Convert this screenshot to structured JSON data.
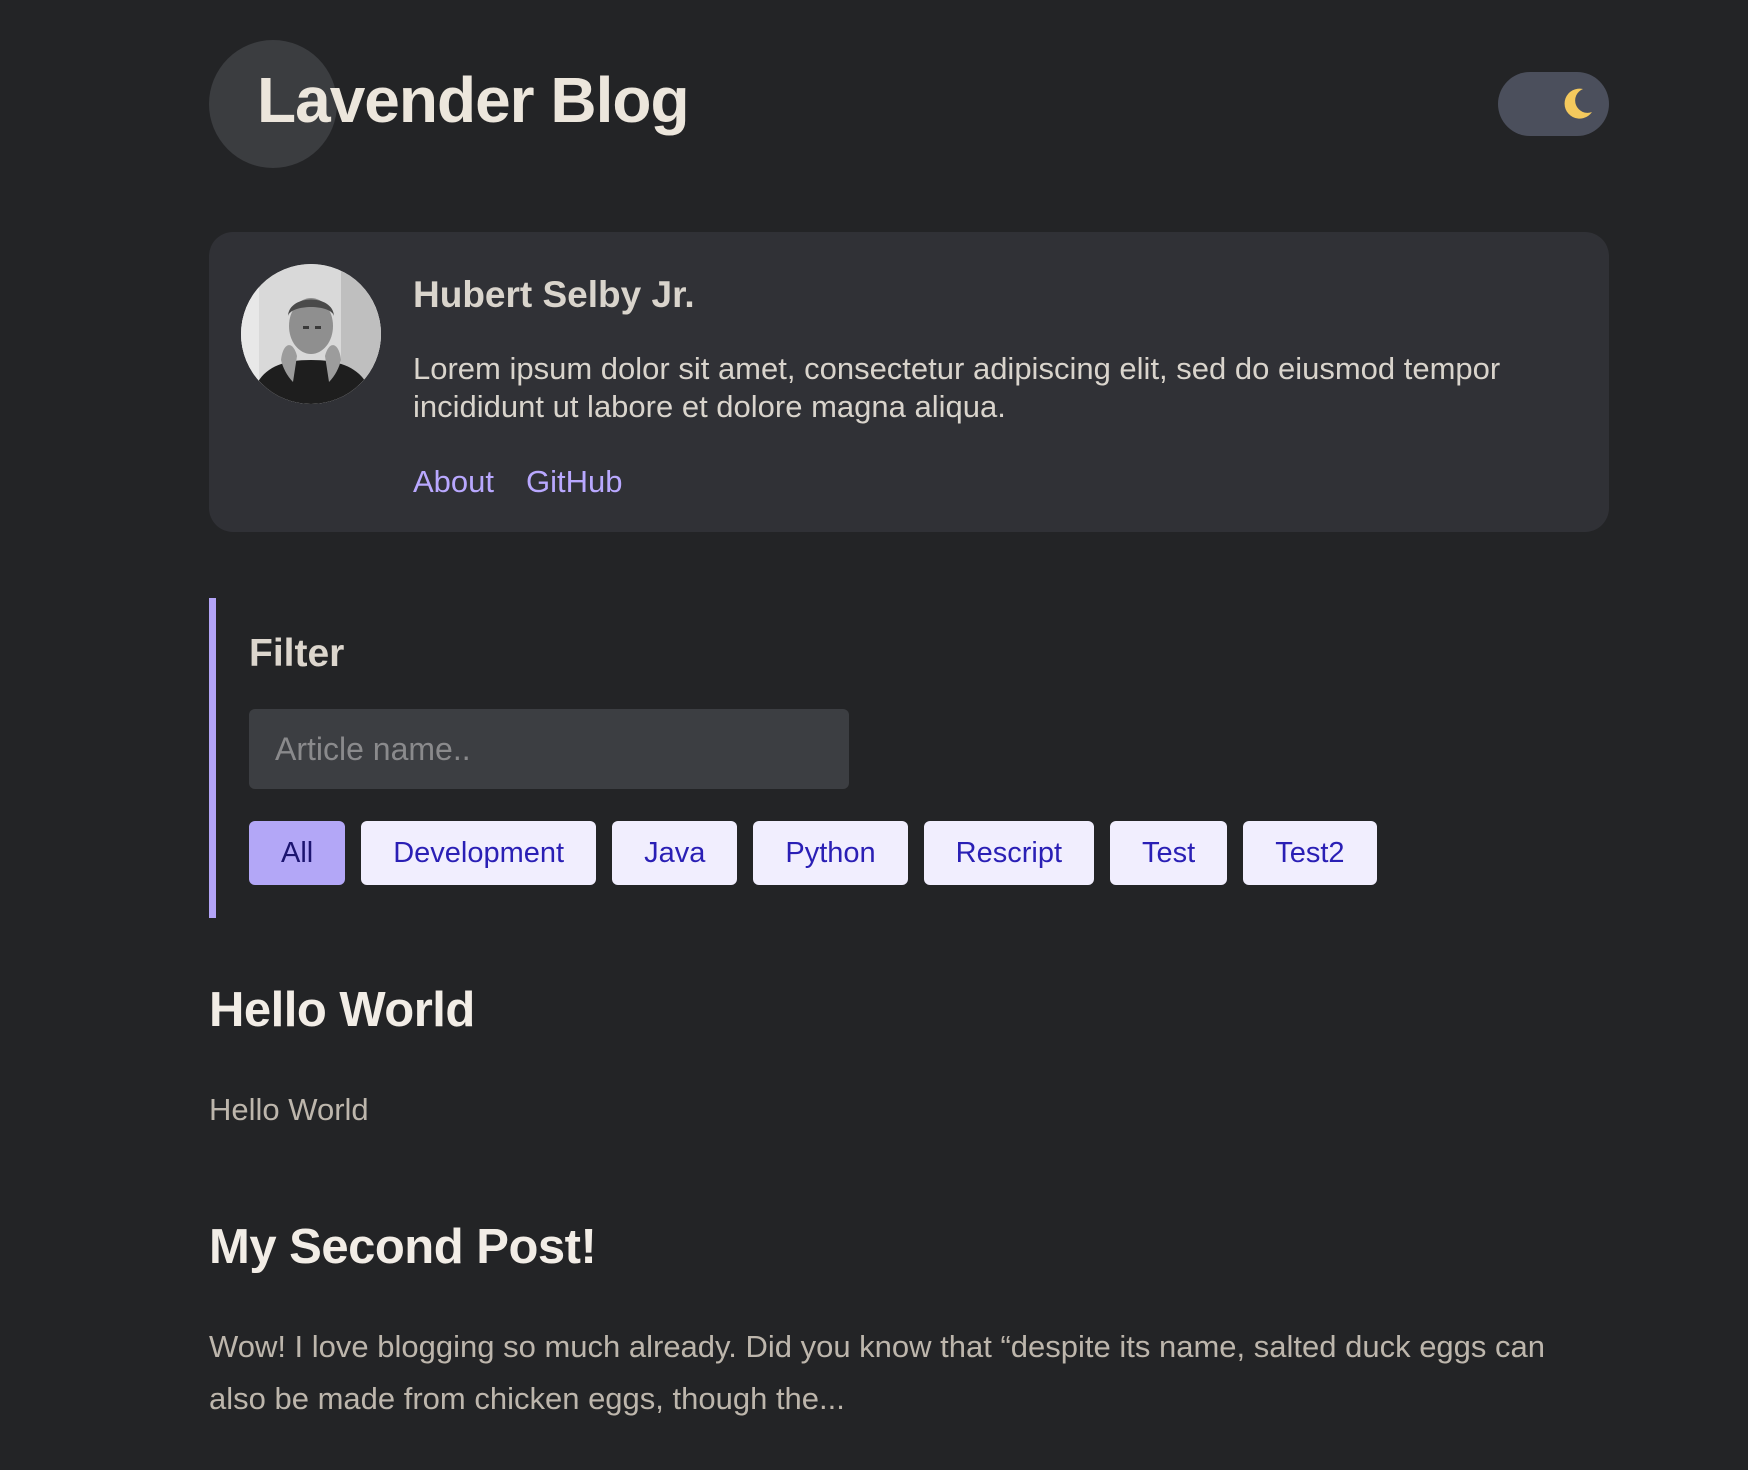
{
  "header": {
    "site_title": "Lavender Blog",
    "theme_toggle_icon": "moon-icon"
  },
  "bio": {
    "name": "Hubert Selby Jr.",
    "description": "Lorem ipsum dolor sit amet, consectetur adipiscing elit, sed do eiusmod tempor incididunt ut labore et dolore magna aliqua.",
    "links": [
      {
        "label": "About"
      },
      {
        "label": "GitHub"
      }
    ]
  },
  "filter": {
    "title": "Filter",
    "search_placeholder": "Article name..",
    "search_value": "",
    "tags": [
      "All",
      "Development",
      "Java",
      "Python",
      "Rescript",
      "Test",
      "Test2"
    ],
    "active_tag": "All"
  },
  "articles": [
    {
      "title": "Hello World",
      "excerpt": "Hello World"
    },
    {
      "title": "My Second Post!",
      "excerpt": "Wow! I love blogging so much already. Did you know that “despite its name, salted duck eggs can also be made from chicken eggs, though the..."
    }
  ],
  "colors": {
    "background": "#232426",
    "card": "#303136",
    "accent": "#b3a4f7",
    "link": "#b9a8ff",
    "tag_background": "#f1eefe",
    "tag_text": "#2a1fb5"
  }
}
